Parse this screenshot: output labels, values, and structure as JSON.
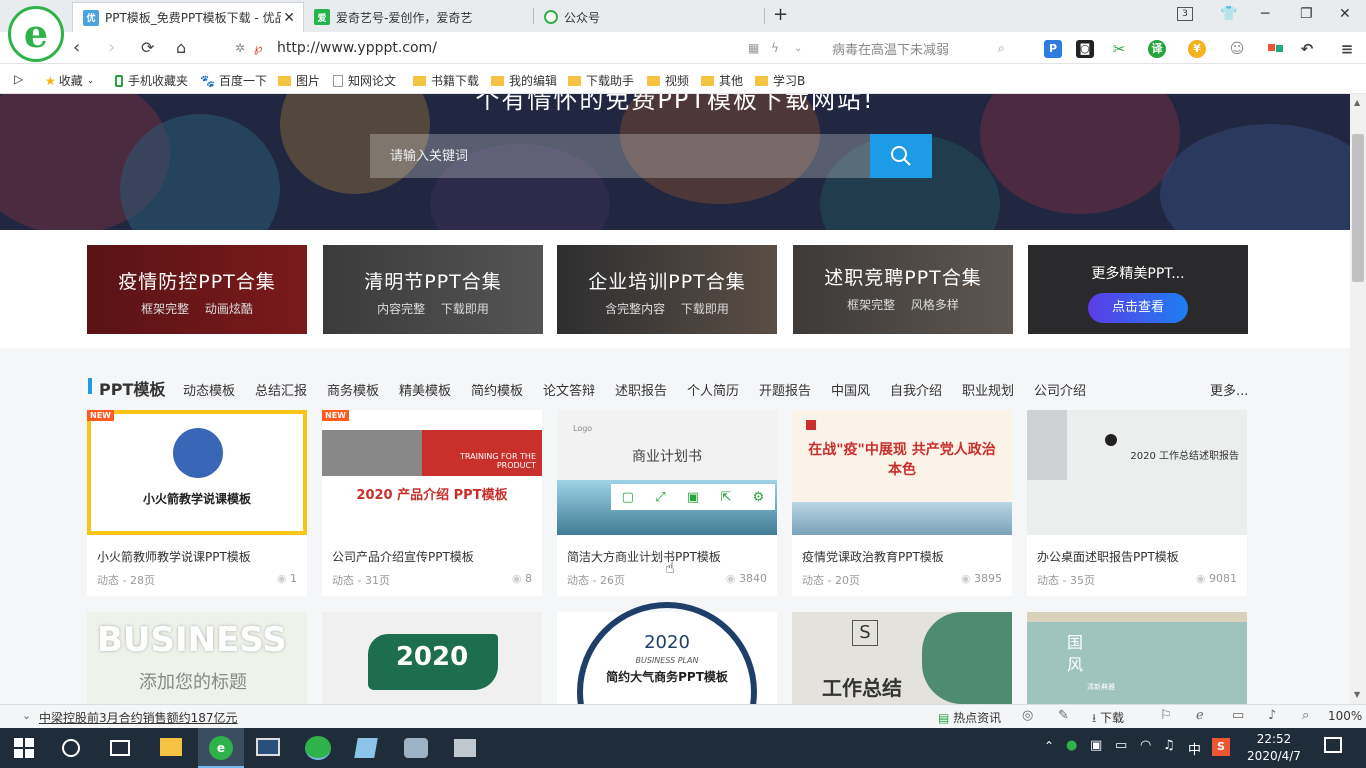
{
  "browser": {
    "tabs": [
      {
        "title": "PPT模板_免费PPT模板下载 - 优品",
        "active": true
      },
      {
        "title": "爱奇艺号-爱创作，爱奇艺",
        "active": false
      },
      {
        "title": "公众号",
        "active": false
      }
    ],
    "new_tab": "+",
    "tab_count": "3",
    "url": "http://www.ypppt.com/",
    "search_hint": "病毒在高温下未减弱",
    "window": {
      "minimize": "─",
      "maximize": "❐",
      "close": "✕"
    }
  },
  "bookmarks": [
    {
      "label": "收藏",
      "icon": "star-icon"
    },
    {
      "label": "手机收藏夹",
      "icon": "phone-icon"
    },
    {
      "label": "百度一下",
      "icon": "baidu-icon"
    },
    {
      "label": "图片",
      "icon": "folder-icon"
    },
    {
      "label": "知网论文",
      "icon": "page-icon"
    },
    {
      "label": "书籍下载",
      "icon": "folder-icon"
    },
    {
      "label": "我的编辑",
      "icon": "folder-icon"
    },
    {
      "label": "下载助手",
      "icon": "folder-icon"
    },
    {
      "label": "视频",
      "icon": "folder-icon"
    },
    {
      "label": "其他",
      "icon": "folder-icon"
    },
    {
      "label": "学习B",
      "icon": "folder-icon"
    }
  ],
  "search": {
    "placeholder": "请输入关键词"
  },
  "banner_title": "个有情怀的免费PPT模板下载网站!",
  "collections": [
    {
      "title": "疫情防控PPT合集",
      "sub": "框架完整 动画炫酷",
      "color": "#5a1316"
    },
    {
      "title": "清明节PPT合集",
      "sub": "内容完整 下载即用",
      "color": "#3b3b3b"
    },
    {
      "title": "企业培训PPT合集",
      "sub": "含完整内容 下载即用",
      "color": "#2e2e30"
    },
    {
      "title": "述职竞聘PPT合集",
      "sub": "框架完整 风格多样",
      "color": "#3d3a38"
    },
    {
      "title": "更多精美PPT...",
      "button": "点击查看",
      "color": "#2a2a2c"
    }
  ],
  "category": {
    "title": "PPT模板",
    "links": [
      "动态模板",
      "总结汇报",
      "商务模板",
      "精美模板",
      "简约模板",
      "论文答辩",
      "述职报告",
      "个人简历",
      "开题报告",
      "中国风",
      "自我介绍",
      "职业规划",
      "公司介绍"
    ],
    "more": "更多..."
  },
  "templates": [
    {
      "name": "小火箭教师教学说课PPT模板",
      "meta": "动态 - 28页",
      "views": "1",
      "badge": "NEW",
      "img_text": "小火箭教学说课模板"
    },
    {
      "name": "公司产品介绍宣传PPT模板",
      "meta": "动态 - 31页",
      "views": "8",
      "badge": "NEW",
      "img_text": "2020 产品介绍 PPT模板",
      "img_sub": "TRAINING FOR THE PRODUCT"
    },
    {
      "name": "简洁大方商业计划书PPT模板",
      "meta": "动态 - 26页",
      "views": "3840",
      "img_text": "商业计划书",
      "img_sub": "Logo"
    },
    {
      "name": "疫情党课政治教育PPT模板",
      "meta": "动态 - 20页",
      "views": "3895",
      "img_text": "在战\"疫\"中展现 共产党人政治本色"
    },
    {
      "name": "办公桌面述职报告PPT模板",
      "meta": "动态 - 35页",
      "views": "9081",
      "img_text": "2020 工作总结述职报告"
    }
  ],
  "templates_row2": [
    {
      "img_text": "BUSINESS",
      "img_sub": "添加您的标题"
    },
    {
      "img_text": "2020"
    },
    {
      "img_text": "2020",
      "img_sub": "BUSINESS PLAN",
      "img_sub2": "简约大气商务PPT模板"
    },
    {
      "img_text": "工作总结",
      "img_sub": "S"
    },
    {
      "img_text": "国风",
      "img_sub": "清新典雅"
    }
  ],
  "statusbar": {
    "news": "中梁控股前3月合约销售额约187亿元",
    "hot": "热点资讯",
    "download": "下载",
    "zoom": "100%"
  },
  "taskbar": {
    "time": "22:52",
    "date": "2020/4/7",
    "ime": "中"
  }
}
